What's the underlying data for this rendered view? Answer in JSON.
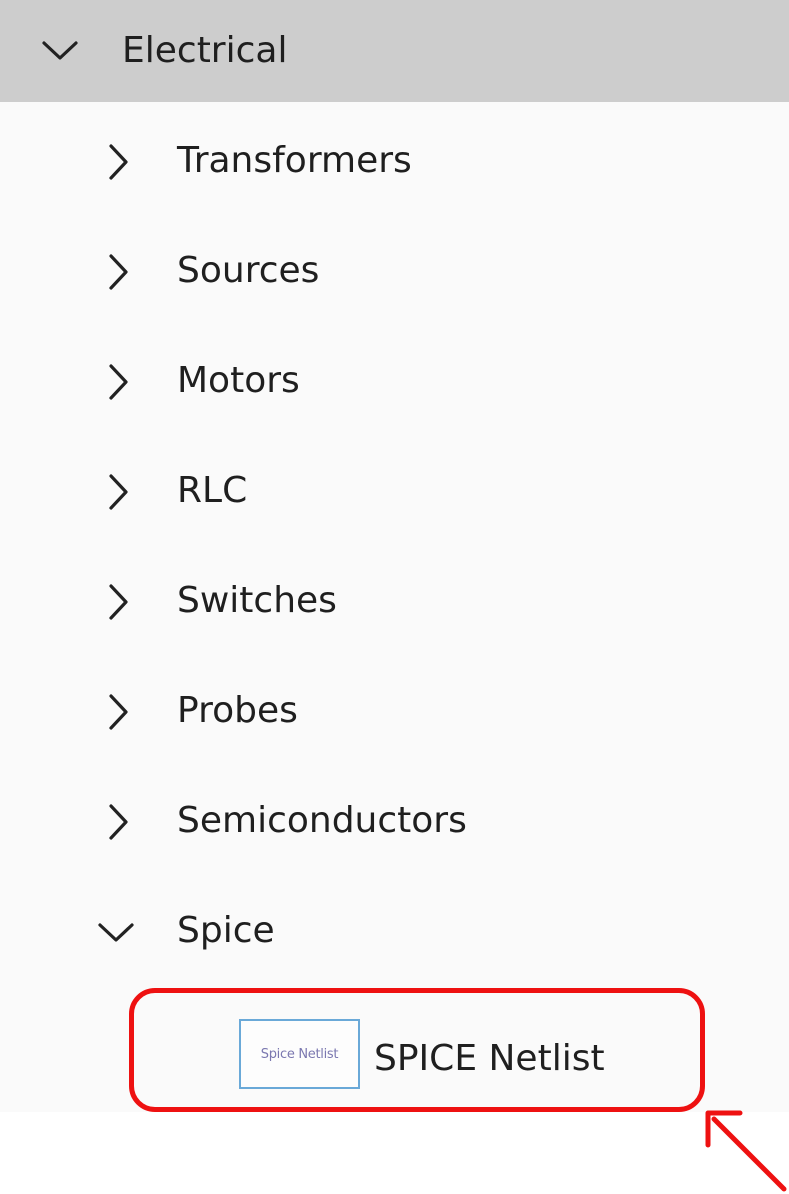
{
  "tree": {
    "category": {
      "label": "Electrical",
      "expanded": true
    },
    "children": [
      {
        "label": "Transformers",
        "expanded": false
      },
      {
        "label": "Sources",
        "expanded": false
      },
      {
        "label": "Motors",
        "expanded": false
      },
      {
        "label": "RLC",
        "expanded": false
      },
      {
        "label": "Switches",
        "expanded": false
      },
      {
        "label": "Probes",
        "expanded": false
      },
      {
        "label": "Semiconductors",
        "expanded": false
      },
      {
        "label": "Spice",
        "expanded": true
      }
    ],
    "leaf": {
      "label": "SPICE Netlist",
      "thumbnail_text": "Spice Netlist"
    }
  },
  "colors": {
    "header_bg": "#cdcdcd",
    "panel_bg": "#fafafa",
    "highlight": "#ee1111",
    "thumbnail_border": "#6aa9d8"
  },
  "icons": {
    "expanded": "chevron-down-icon",
    "collapsed": "chevron-right-icon",
    "annotation": "arrow-icon"
  }
}
